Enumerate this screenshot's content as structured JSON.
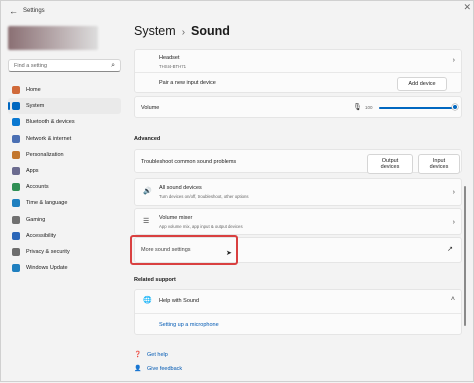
{
  "window": {
    "title": "Settings",
    "back_glyph": "←"
  },
  "search": {
    "placeholder": "Find a setting"
  },
  "nav": [
    {
      "label": "Home",
      "icon": "home-icon",
      "color": "#d06a3a"
    },
    {
      "label": "System",
      "icon": "system-icon",
      "color": "#0067c0",
      "active": true
    },
    {
      "label": "Bluetooth & devices",
      "icon": "bluetooth-icon",
      "color": "#0a78d1"
    },
    {
      "label": "Network & internet",
      "icon": "network-icon",
      "color": "#4a6fb3"
    },
    {
      "label": "Personalization",
      "icon": "brush-icon",
      "color": "#c2762e"
    },
    {
      "label": "Apps",
      "icon": "apps-icon",
      "color": "#6b6b8f"
    },
    {
      "label": "Accounts",
      "icon": "person-icon",
      "color": "#2f8f54"
    },
    {
      "label": "Time & language",
      "icon": "globe-clock-icon",
      "color": "#1f7fbf"
    },
    {
      "label": "Gaming",
      "icon": "gamepad-icon",
      "color": "#707070"
    },
    {
      "label": "Accessibility",
      "icon": "accessibility-icon",
      "color": "#2a66b8"
    },
    {
      "label": "Privacy & security",
      "icon": "shield-icon",
      "color": "#6d6d6d"
    },
    {
      "label": "Windows Update",
      "icon": "update-icon",
      "color": "#1f7fbf"
    }
  ],
  "breadcrumb": {
    "parent": "System",
    "separator": "›",
    "current": "Sound"
  },
  "headset": {
    "title": "Headset",
    "subtitle": "THSI4-BTH71"
  },
  "pair": {
    "label": "Pair a new input device",
    "button": "Add device"
  },
  "volume": {
    "label": "Volume",
    "value": "100",
    "level": 1.0
  },
  "advanced": {
    "heading": "Advanced",
    "troubleshoot": {
      "label": "Troubleshoot common sound problems",
      "output": "Output devices",
      "input": "Input devices"
    },
    "all_devices": {
      "title": "All sound devices",
      "subtitle": "Turn devices on/off, troubleshoot, other options"
    },
    "mixer": {
      "title": "Volume mixer",
      "subtitle": "App volume mix, app input & output devices"
    },
    "more": {
      "label": "More sound settings",
      "icon": "open-external-icon"
    }
  },
  "related": {
    "heading": "Related support",
    "help_with_sound": "Help with Sound",
    "setup_mic": "Setting up a microphone"
  },
  "footer": {
    "get_help": "Get help",
    "feedback": "Give feedback"
  }
}
